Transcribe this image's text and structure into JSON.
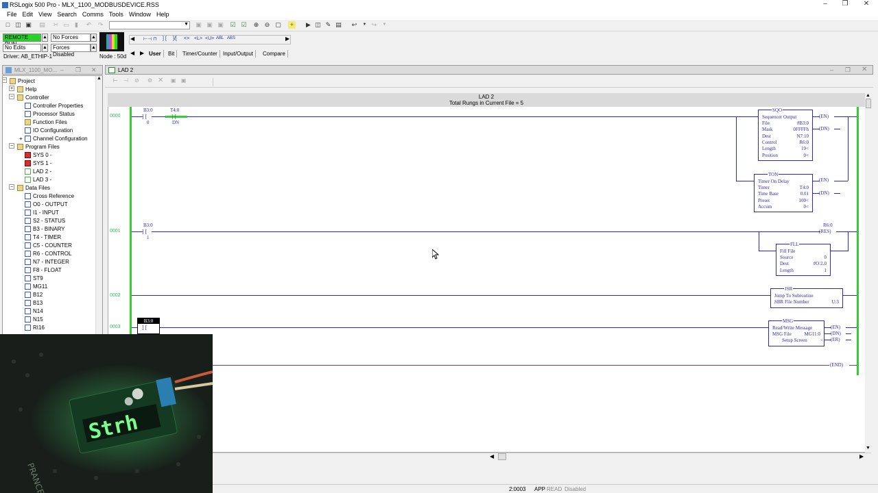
{
  "window": {
    "title": "RSLogix 500 Pro - MLX_1100_MODBUSDEVICE.RSS"
  },
  "menu": [
    "File",
    "Edit",
    "View",
    "Search",
    "Comms",
    "Tools",
    "Window",
    "Help"
  ],
  "status": {
    "mode": "REMOTE RUN",
    "forces": "No Forces",
    "edits": "No Edits",
    "forces_enabled": "Forces Disabled",
    "driver": "Driver: AB_ETHIP-1",
    "node": "Node : 50d"
  },
  "instruction_tabs": [
    "User",
    "Bit",
    "Timer/Counter",
    "Input/Output",
    "Compare"
  ],
  "project_panel": {
    "title": "MLX_1100_MO...",
    "items": [
      {
        "label": "Project",
        "indent": 1,
        "icon": "folder"
      },
      {
        "label": "Help",
        "indent": 2,
        "icon": "folder"
      },
      {
        "label": "Controller",
        "indent": 2,
        "icon": "folder"
      },
      {
        "label": "Controller Properties",
        "indent": 3,
        "icon": "properties"
      },
      {
        "label": "Processor Status",
        "indent": 3,
        "icon": "file"
      },
      {
        "label": "Function Files",
        "indent": 3,
        "icon": "function"
      },
      {
        "label": "IO Configuration",
        "indent": 3,
        "icon": "io"
      },
      {
        "label": "Channel Configuration",
        "indent": 3,
        "icon": "channel"
      },
      {
        "label": "Program Files",
        "indent": 2,
        "icon": "folder"
      },
      {
        "label": "SYS 0 -",
        "indent": 3,
        "icon": "sys"
      },
      {
        "label": "SYS 1 -",
        "indent": 3,
        "icon": "sys"
      },
      {
        "label": "LAD 2 -",
        "indent": 3,
        "icon": "lad"
      },
      {
        "label": "LAD 3 -",
        "indent": 3,
        "icon": "lad"
      },
      {
        "label": "Data Files",
        "indent": 2,
        "icon": "folder"
      },
      {
        "label": "Cross Reference",
        "indent": 3,
        "icon": "xref"
      },
      {
        "label": "O0 - OUTPUT",
        "indent": 3,
        "icon": "file"
      },
      {
        "label": "I1 - INPUT",
        "indent": 3,
        "icon": "file"
      },
      {
        "label": "S2 - STATUS",
        "indent": 3,
        "icon": "file"
      },
      {
        "label": "B3 - BINARY",
        "indent": 3,
        "icon": "file"
      },
      {
        "label": "T4 - TIMER",
        "indent": 3,
        "icon": "file"
      },
      {
        "label": "C5 - COUNTER",
        "indent": 3,
        "icon": "file"
      },
      {
        "label": "R6 - CONTROL",
        "indent": 3,
        "icon": "file"
      },
      {
        "label": "N7 - INTEGER",
        "indent": 3,
        "icon": "file"
      },
      {
        "label": "F8 - FLOAT",
        "indent": 3,
        "icon": "file"
      },
      {
        "label": "ST9",
        "indent": 3,
        "icon": "file"
      },
      {
        "label": "MG11",
        "indent": 3,
        "icon": "file"
      },
      {
        "label": "B12",
        "indent": 3,
        "icon": "file"
      },
      {
        "label": "B13",
        "indent": 3,
        "icon": "file"
      },
      {
        "label": "N14",
        "indent": 3,
        "icon": "file"
      },
      {
        "label": "N15",
        "indent": 3,
        "icon": "file"
      },
      {
        "label": "RI16",
        "indent": 3,
        "icon": "file"
      }
    ]
  },
  "ladder": {
    "window_title": "LAD 2",
    "title": "LAD 2",
    "subtitle": "Total Rungs in Current File = 5",
    "rung_numbers": [
      "0000",
      "0001",
      "0002",
      "0003"
    ],
    "r0": {
      "c1_addr": "B3:0",
      "c1_bit": "0",
      "c2_addr": "T4:0",
      "c2_bit": "DN",
      "sqo": {
        "title": "SQO",
        "desc": "Sequencer Output",
        "rows": [
          [
            "File",
            "#B3:0"
          ],
          [
            "Mask",
            "0FFFFh"
          ],
          [
            "Dest",
            "N7:10"
          ],
          [
            "Control",
            "R6:0"
          ],
          [
            "Length",
            "19<"
          ],
          [
            "Position",
            "0<"
          ]
        ]
      },
      "ton": {
        "title": "TON",
        "desc": "Timer On Delay",
        "rows": [
          [
            "Timer",
            "T4:0"
          ],
          [
            "Time Base",
            "0.01"
          ],
          [
            "Preset",
            "100<"
          ],
          [
            "Accum",
            "0<"
          ]
        ]
      },
      "en": "EN",
      "dn": "DN"
    },
    "r1": {
      "c1_addr": "B3:0",
      "c1_bit": "1",
      "res_addr": "R6:0",
      "res": "RES",
      "fll": {
        "title": "FLL",
        "desc": "Fill File",
        "rows": [
          [
            "Source",
            "0"
          ],
          [
            "Dest",
            "#O:2.0"
          ],
          [
            "Length",
            "1"
          ]
        ]
      }
    },
    "r2": {
      "jsr": {
        "title": "JSR",
        "desc": "Jump To Subroutine",
        "rows": [
          [
            "SBR File Number",
            "U:3"
          ]
        ]
      }
    },
    "r3": {
      "c1_addr": "B3:0",
      "msg": {
        "title": "MSG",
        "desc": "Read/Write Message",
        "rows": [
          [
            "MSG File",
            "MG11:0"
          ],
          [
            "Setup Screen",
            "<"
          ]
        ]
      },
      "en": "EN",
      "dn": "DN",
      "er": "ER"
    },
    "end": "END"
  },
  "bottom_status": {
    "position": "2:0003",
    "app": "APP",
    "read": "READ",
    "state": "Disabled"
  },
  "photo": {
    "display": "Strh",
    "board_text": "PRANCE"
  }
}
